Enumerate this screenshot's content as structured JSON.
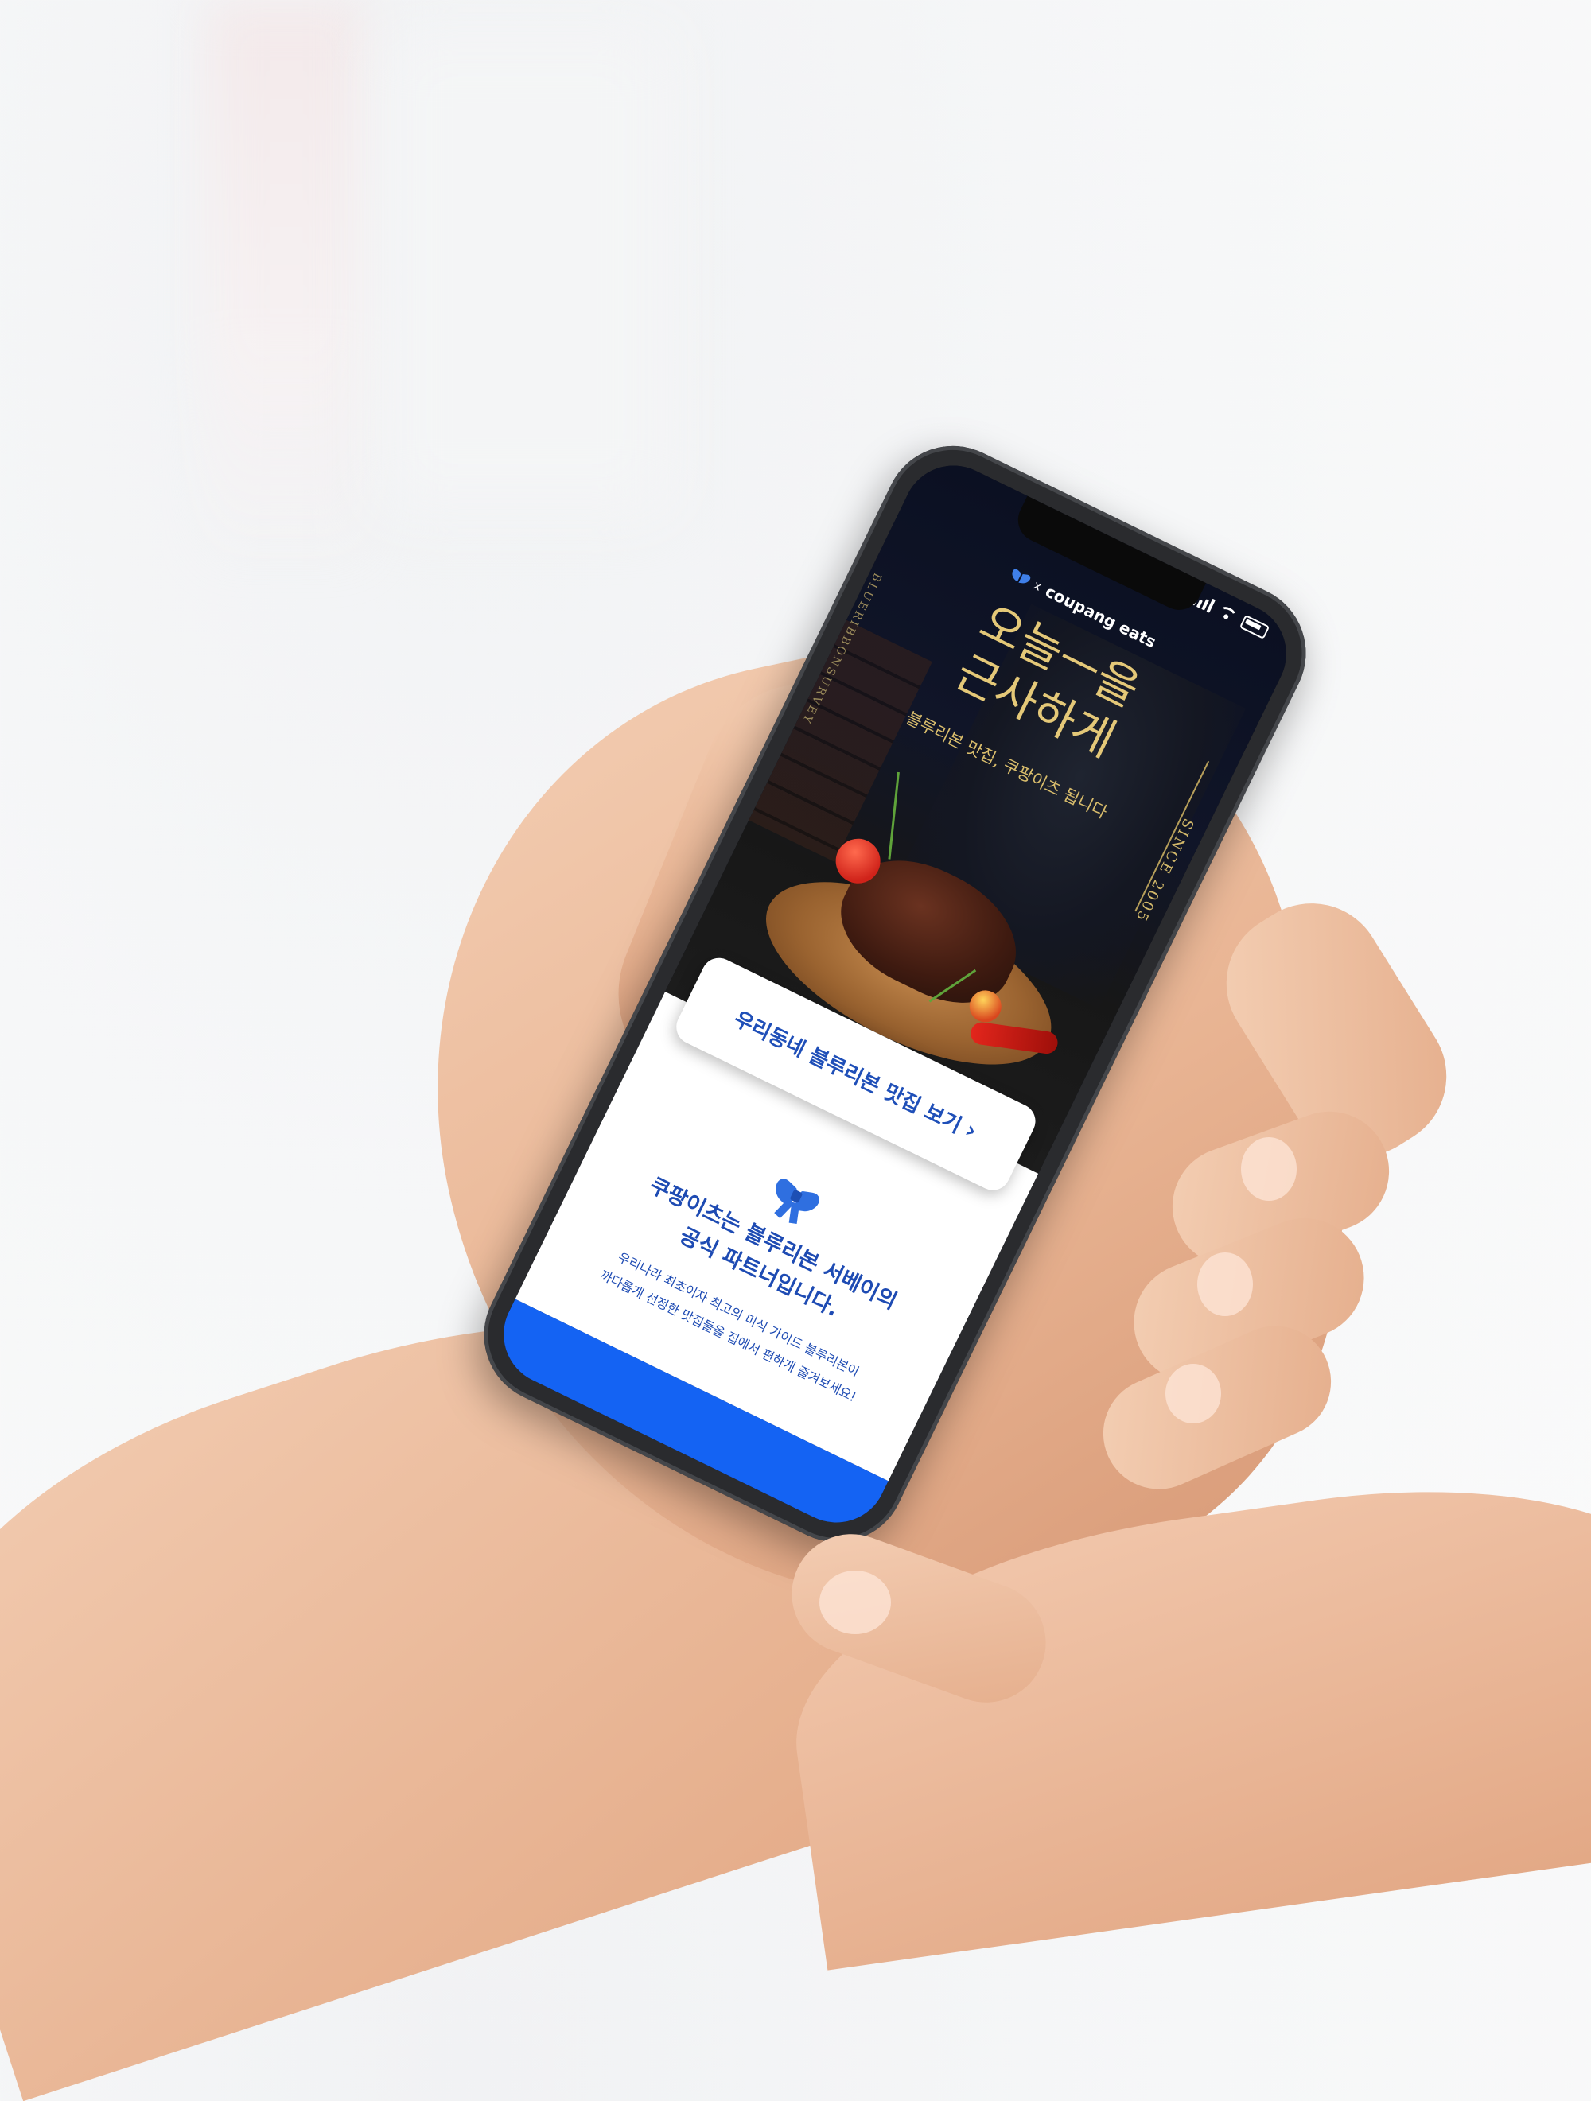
{
  "promo": {
    "partner_name": "coupang eats",
    "partner_separator": "x",
    "vertical_brand_text": "BLUERIBBONSURVEY",
    "since_text": "SINCE 2005",
    "headline_line1": "오늘ㅡ을",
    "headline_line2": "근사하게",
    "subheadline": "블루리본 맛집, 쿠팡이츠 됩니다",
    "cta_label": "우리동네 블루리본 맛집 보기",
    "cta_chevron": "›"
  },
  "info": {
    "title_line1": "쿠팡이츠는 블루리본 서베이의",
    "title_line2": "공식 파트너입니다.",
    "desc_line1": "우리나라 최초이자 최고의 미식 가이드 블루리본이",
    "desc_line2": "까다롭게 선정한 맛집들을 집에서 편하게 즐겨보세요!"
  },
  "icons": {
    "ribbon": "blue-ribbon-icon",
    "signal": "cellular-signal-icon",
    "wifi": "wifi-icon",
    "battery": "battery-icon"
  },
  "colors": {
    "accent_blue": "#1463f3",
    "text_blue": "#1e4bb3",
    "gold": "#e4c878",
    "hero_bg": "#0b1022"
  }
}
